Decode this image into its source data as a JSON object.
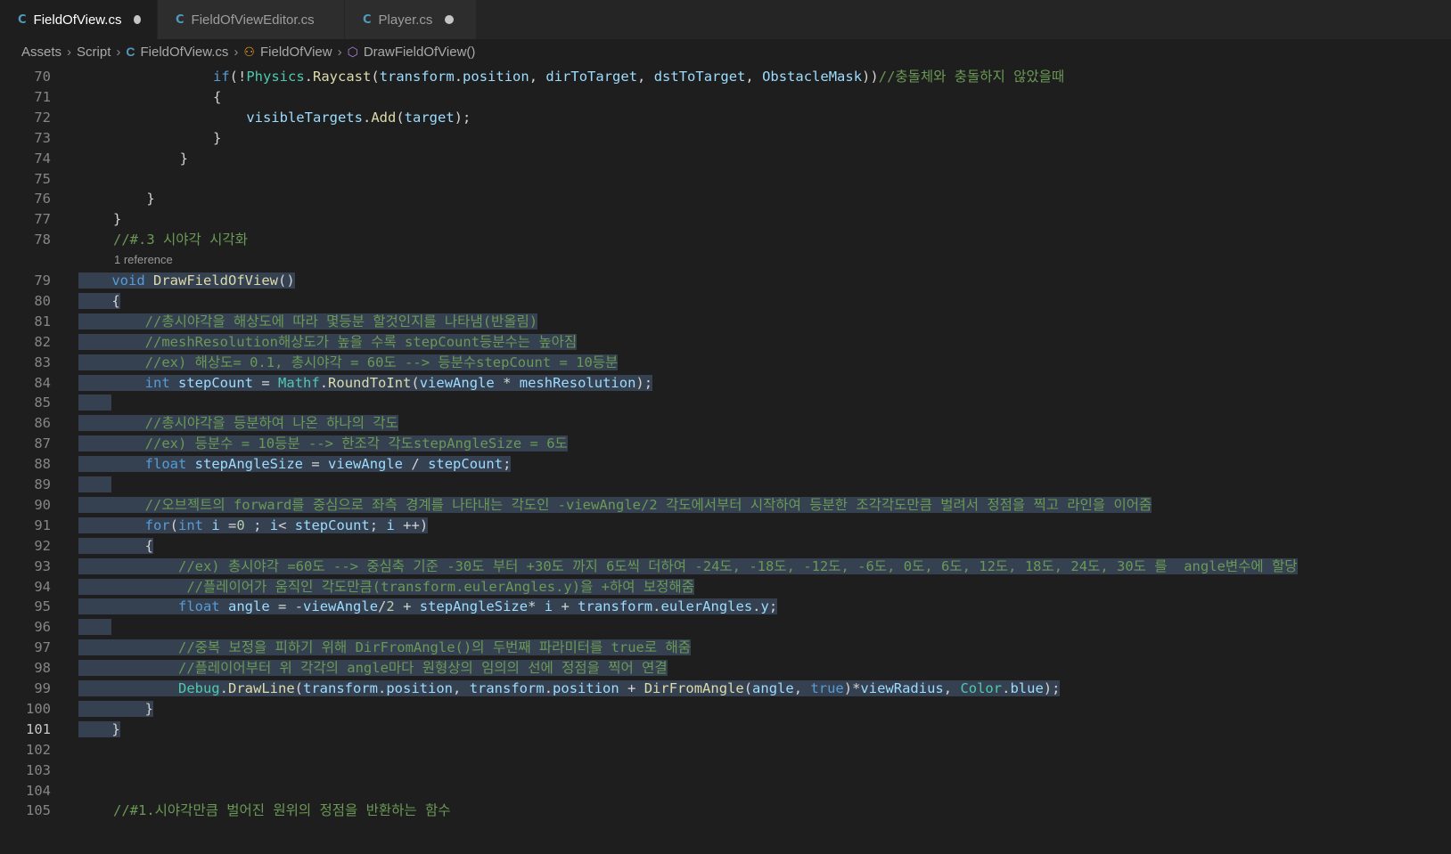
{
  "tabs": [
    {
      "label": "FieldOfView.cs",
      "icon": "csharp-file-icon",
      "active": true,
      "modified": true
    },
    {
      "label": "FieldOfViewEditor.cs",
      "icon": "csharp-file-icon",
      "active": false,
      "modified": false
    },
    {
      "label": "Player.cs",
      "icon": "csharp-file-icon",
      "active": false,
      "modified": true
    }
  ],
  "breadcrumb": {
    "items": [
      "Assets",
      "Script",
      "FieldOfView.cs",
      "FieldOfView",
      "DrawFieldOfView()"
    ]
  },
  "codelens": "1 reference",
  "line_numbers": [
    "70",
    "71",
    "72",
    "73",
    "74",
    "75",
    "76",
    "77",
    "78",
    "79",
    "80",
    "81",
    "82",
    "83",
    "84",
    "85",
    "86",
    "87",
    "88",
    "89",
    "90",
    "91",
    "92",
    "93",
    "94",
    "95",
    "96",
    "97",
    "98",
    "99",
    "100",
    "101",
    "102",
    "103",
    "104",
    "105"
  ],
  "lines": [
    "            if(!Physics.Raycast(transform.position, dirToTarget, dstToTarget, ObstacleMask))//충돌체와 충돌하지 않았을때",
    "            {",
    "                visibleTargets.Add(target);",
    "            }",
    "        }",
    "",
    "    }",
    "}",
    "//#.3 시야각 시각화",
    "void DrawFieldOfView()",
    "{",
    "    //총시야각을 해상도에 따라 몇등분 할것인지를 나타냄(반올림)",
    "    //meshResolution해상도가 높을 수록 stepCount등분수는 높아짐",
    "    //ex) 해상도= 0.1, 총시야각 = 60도 --> 등분수stepCount = 10등분",
    "    int stepCount = Mathf.RoundToInt(viewAngle * meshResolution);",
    "",
    "    //총시야각을 등분하여 나온 하나의 각도",
    "    //ex) 등분수 = 10등분 --> 한조각 각도stepAngleSize = 6도",
    "    float stepAngleSize = viewAngle / stepCount;",
    "",
    "    //오브젝트의 forward를 중심으로 좌측 경계를 나타내는 각도인 -viewAngle/2 각도에서부터 시작하여 등분한 조각각도만큼 벌려서 정점을 찍고 라인을 이어줌",
    "    for(int i =0 ; i< stepCount; i ++)",
    "    {",
    "        //ex) 총시야각 =60도 --> 중심축 기준 -30도 부터 +30도 까지 6도씩 더하여 -24도, -18도, -12도, -6도, 0도, 6도, 12도, 18도, 24도, 30도 를  angle변수에 할당",
    "         //플레이어가 움직인 각도만큼(transform.eulerAngles.y)을 +하여 보정해줌",
    "        float angle = -viewAngle/2 + stepAngleSize* i + transform.eulerAngles.y;",
    "",
    "        //중복 보정을 피하기 위해 DirFromAngle()의 두번째 파라미터를 true로 해줌",
    "        //플레이어부터 위 각각의 angle마다 원형상의 임의의 선에 정점을 찍어 연결",
    "        Debug.DrawLine(transform.position, transform.position + DirFromAngle(angle, true)*viewRadius, Color.blue);",
    "    }",
    "}",
    "",
    "",
    "",
    "//#1.시야각만큼 벌어진 원위의 정점을 반환하는 함수"
  ]
}
